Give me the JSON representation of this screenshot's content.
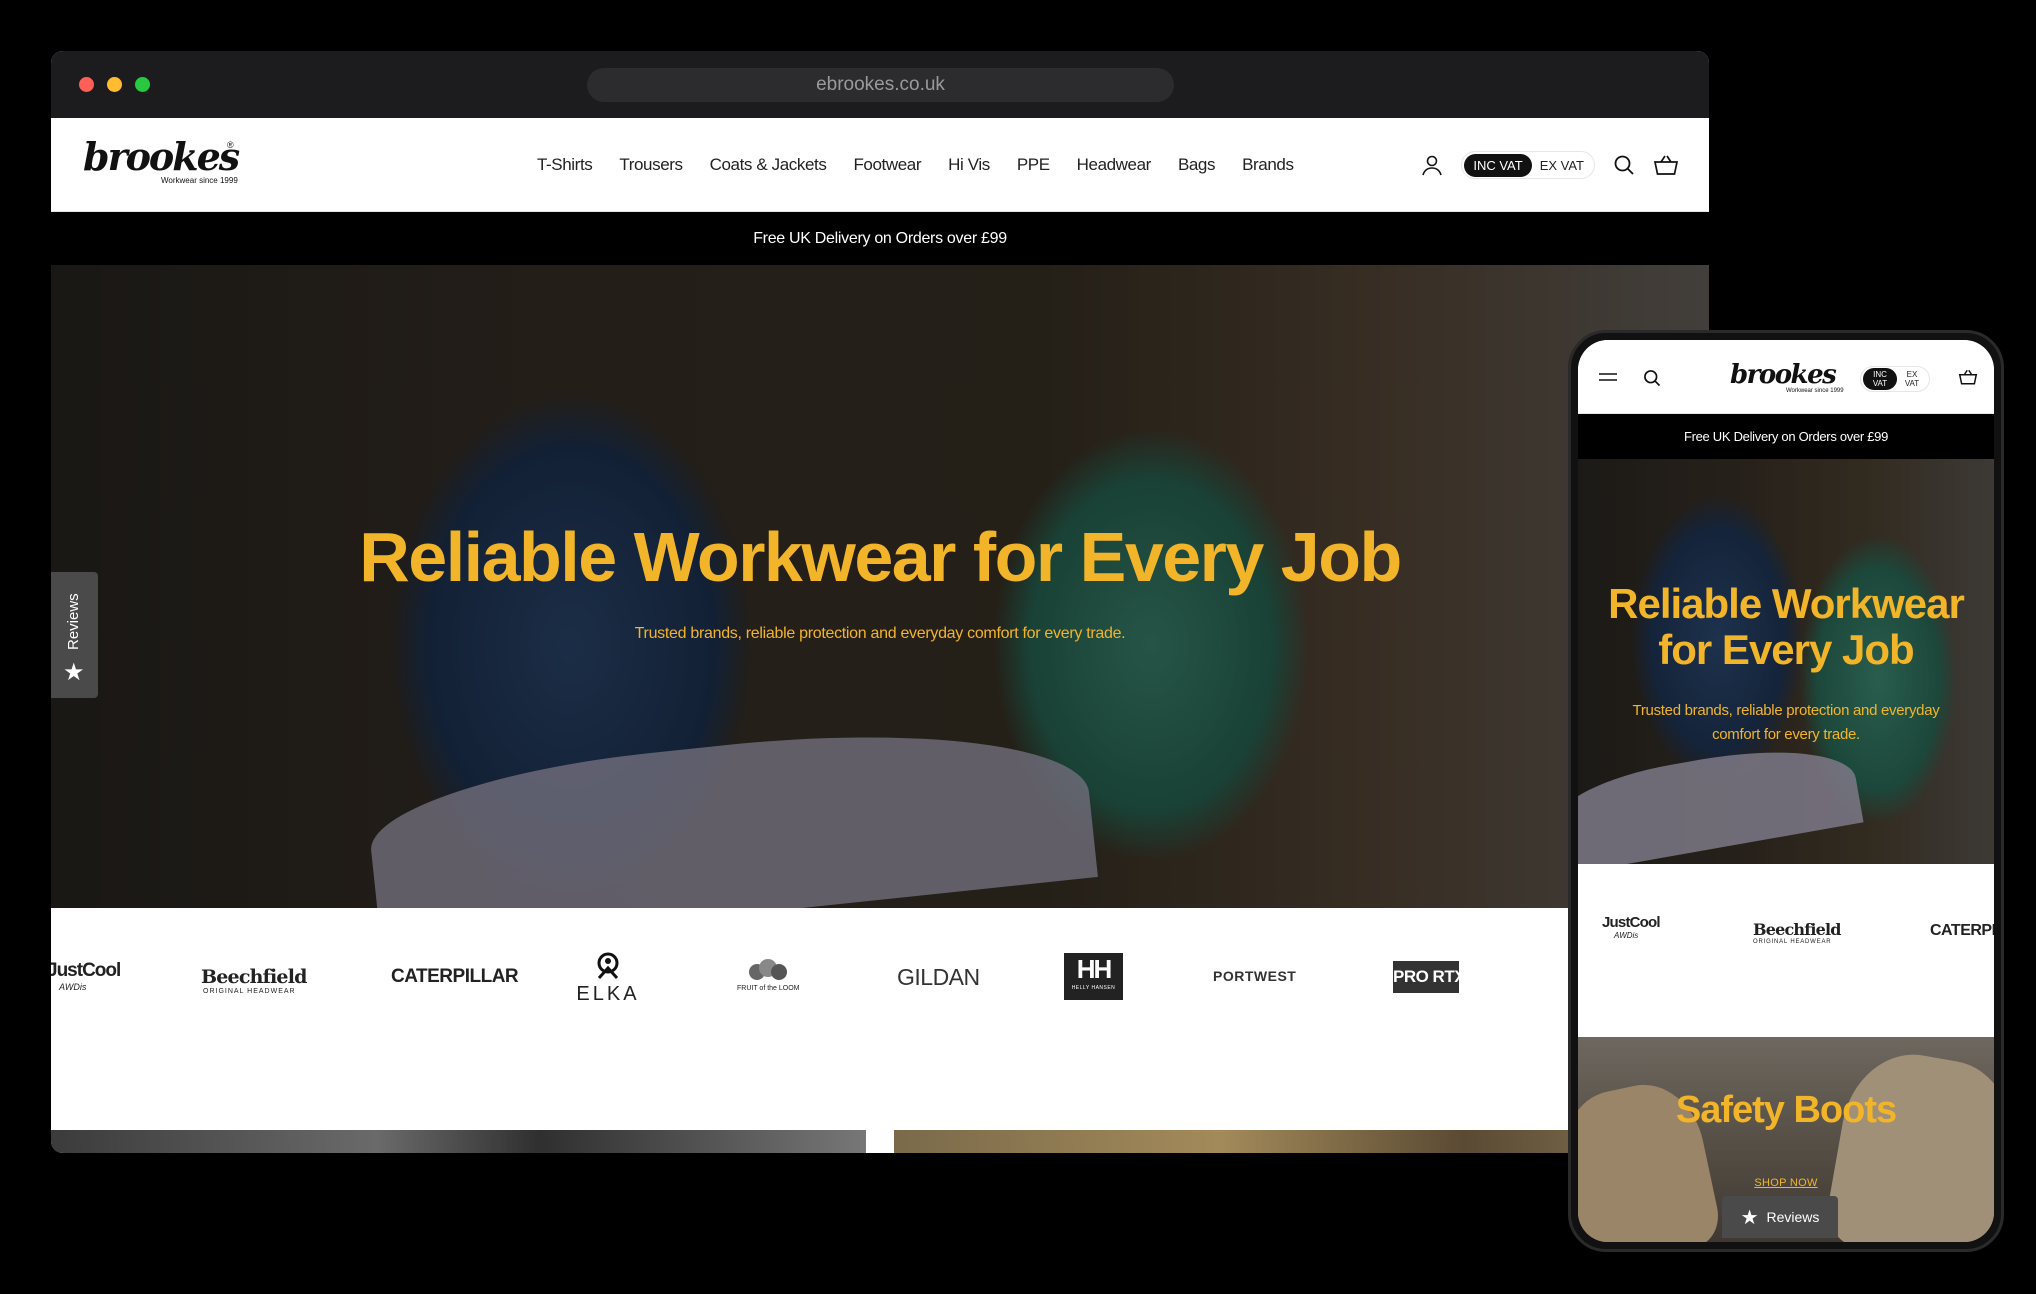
{
  "browser": {
    "url": "ebrookes.co.uk"
  },
  "logo": {
    "text": "brookes",
    "tagline": "Workwear since 1999",
    "reg": "®"
  },
  "nav": {
    "items": [
      "T-Shirts",
      "Trousers",
      "Coats & Jackets",
      "Footwear",
      "Hi Vis",
      "PPE",
      "Headwear",
      "Bags",
      "Brands"
    ]
  },
  "vat": {
    "on": "INC VAT",
    "off": "EX VAT",
    "mobile_on": "INC VAT",
    "mobile_off": "EX VAT"
  },
  "announcement": "Free UK Delivery on Orders over £99",
  "hero": {
    "title": "Reliable Workwear for Every Job",
    "subtitle": "Trusted brands, reliable protection and everyday comfort for every trade."
  },
  "reviews": {
    "label": "Reviews"
  },
  "brands": {
    "desktop": [
      "JustCool",
      "Beechfield",
      "CATERPILLAR",
      "ELKA",
      "FRUIT of the LOOM",
      "GILDAN",
      "HH",
      "PORTWEST",
      "PRO RTX"
    ],
    "mobile": [
      "JustCool",
      "Beechfield",
      "CATERPILLAR"
    ],
    "sublabels": {
      "justcool": "AWDis",
      "beechfield": "ORIGINAL HEADWEAR",
      "hh": "HELLY HANSEN"
    }
  },
  "mobile": {
    "hero_title": "Reliable Workwear for Every Job",
    "hero_subtitle": "Trusted brands, reliable protection and everyday comfort for every trade.",
    "boots_title": "Safety Boots",
    "boots_link": "SHOP NOW"
  },
  "colors": {
    "accent": "#f2b52a",
    "black": "#000000"
  }
}
